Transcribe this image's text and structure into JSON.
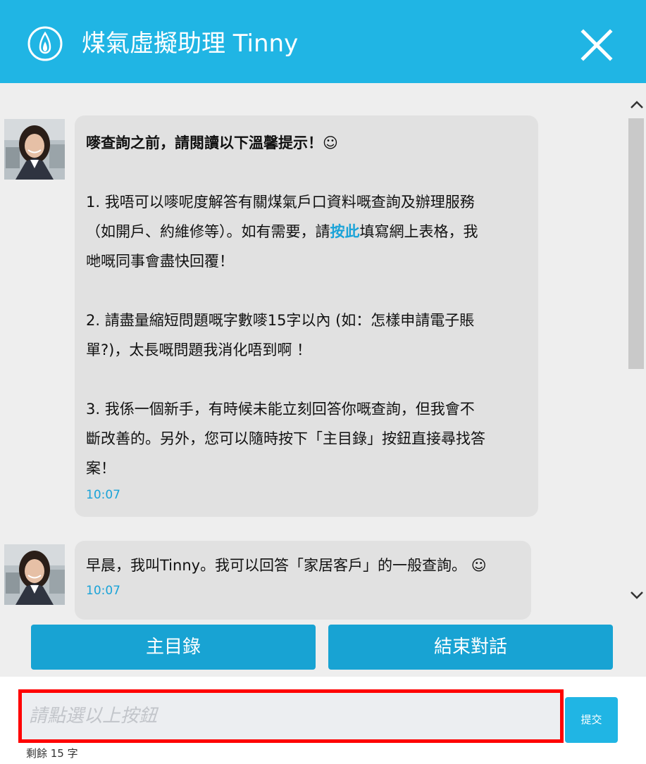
{
  "header": {
    "title": "煤氣虛擬助理 Tinny",
    "logo_icon": "flame-icon",
    "close_icon": "close-icon"
  },
  "messages": [
    {
      "title": "嘜查詢之前，請閱讀以下溫馨提示！☺",
      "p1_a": "1. 我唔可以嘜呢度解答有關煤氣戶口資料嘅查詢及辦理服務",
      "p1_b": "（如開戶、約維修等）。如有需要，請",
      "p1_link": "按此",
      "p1_c": "填寫網上表格，我",
      "p1_d": "哋嘅同事會盡快回覆！",
      "p2_a": "2. 請盡量縮短問題嘅字數嘜15字以內 (如：怎樣申請電子賬",
      "p2_b": "單?)，太長嘅問題我消化唔到啊 ！",
      "p3_a": "3. 我係一個新手，有時候未能立刻回答你嘅查詢，但我會不",
      "p3_b": "斷改善的。另外，您可以隨時按下「主目錄」按鈕直接尋找答",
      "p3_c": "案！",
      "time": "10:07"
    },
    {
      "text": "早晨，我叫Tinny。我可以回答「家居客戶」的一般查詢。 ☺",
      "time": "10:07"
    }
  ],
  "buttons": {
    "main_menu": "主目錄",
    "end_chat": "結束對話"
  },
  "input": {
    "value": "",
    "placeholder": "請點選以上按鈕"
  },
  "submit_label": "提交",
  "remaining_text": "剩餘 15 字",
  "colors": {
    "brand": "#20b5e4",
    "button": "#18a3d3",
    "bubble": "#e1e1e1",
    "link": "#1aa3d8",
    "highlight_border": "#ff0000"
  }
}
